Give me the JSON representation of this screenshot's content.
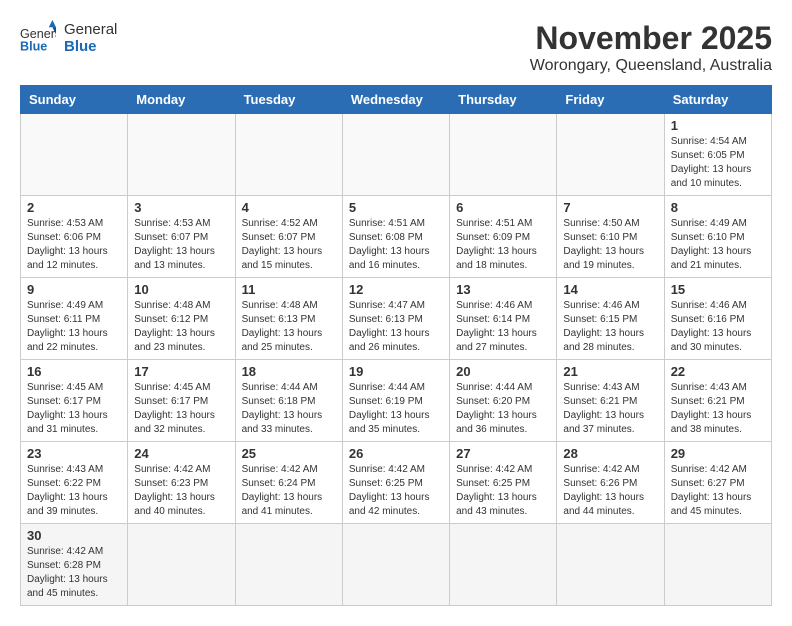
{
  "header": {
    "logo_general": "General",
    "logo_blue": "Blue",
    "month": "November 2025",
    "location": "Worongary, Queensland, Australia"
  },
  "weekdays": [
    "Sunday",
    "Monday",
    "Tuesday",
    "Wednesday",
    "Thursday",
    "Friday",
    "Saturday"
  ],
  "weeks": [
    [
      {
        "day": "",
        "info": ""
      },
      {
        "day": "",
        "info": ""
      },
      {
        "day": "",
        "info": ""
      },
      {
        "day": "",
        "info": ""
      },
      {
        "day": "",
        "info": ""
      },
      {
        "day": "",
        "info": ""
      },
      {
        "day": "1",
        "info": "Sunrise: 4:54 AM\nSunset: 6:05 PM\nDaylight: 13 hours and 10 minutes."
      }
    ],
    [
      {
        "day": "2",
        "info": "Sunrise: 4:53 AM\nSunset: 6:06 PM\nDaylight: 13 hours and 12 minutes."
      },
      {
        "day": "3",
        "info": "Sunrise: 4:53 AM\nSunset: 6:07 PM\nDaylight: 13 hours and 13 minutes."
      },
      {
        "day": "4",
        "info": "Sunrise: 4:52 AM\nSunset: 6:07 PM\nDaylight: 13 hours and 15 minutes."
      },
      {
        "day": "5",
        "info": "Sunrise: 4:51 AM\nSunset: 6:08 PM\nDaylight: 13 hours and 16 minutes."
      },
      {
        "day": "6",
        "info": "Sunrise: 4:51 AM\nSunset: 6:09 PM\nDaylight: 13 hours and 18 minutes."
      },
      {
        "day": "7",
        "info": "Sunrise: 4:50 AM\nSunset: 6:10 PM\nDaylight: 13 hours and 19 minutes."
      },
      {
        "day": "8",
        "info": "Sunrise: 4:49 AM\nSunset: 6:10 PM\nDaylight: 13 hours and 21 minutes."
      }
    ],
    [
      {
        "day": "9",
        "info": "Sunrise: 4:49 AM\nSunset: 6:11 PM\nDaylight: 13 hours and 22 minutes."
      },
      {
        "day": "10",
        "info": "Sunrise: 4:48 AM\nSunset: 6:12 PM\nDaylight: 13 hours and 23 minutes."
      },
      {
        "day": "11",
        "info": "Sunrise: 4:48 AM\nSunset: 6:13 PM\nDaylight: 13 hours and 25 minutes."
      },
      {
        "day": "12",
        "info": "Sunrise: 4:47 AM\nSunset: 6:13 PM\nDaylight: 13 hours and 26 minutes."
      },
      {
        "day": "13",
        "info": "Sunrise: 4:46 AM\nSunset: 6:14 PM\nDaylight: 13 hours and 27 minutes."
      },
      {
        "day": "14",
        "info": "Sunrise: 4:46 AM\nSunset: 6:15 PM\nDaylight: 13 hours and 28 minutes."
      },
      {
        "day": "15",
        "info": "Sunrise: 4:46 AM\nSunset: 6:16 PM\nDaylight: 13 hours and 30 minutes."
      }
    ],
    [
      {
        "day": "16",
        "info": "Sunrise: 4:45 AM\nSunset: 6:17 PM\nDaylight: 13 hours and 31 minutes."
      },
      {
        "day": "17",
        "info": "Sunrise: 4:45 AM\nSunset: 6:17 PM\nDaylight: 13 hours and 32 minutes."
      },
      {
        "day": "18",
        "info": "Sunrise: 4:44 AM\nSunset: 6:18 PM\nDaylight: 13 hours and 33 minutes."
      },
      {
        "day": "19",
        "info": "Sunrise: 4:44 AM\nSunset: 6:19 PM\nDaylight: 13 hours and 35 minutes."
      },
      {
        "day": "20",
        "info": "Sunrise: 4:44 AM\nSunset: 6:20 PM\nDaylight: 13 hours and 36 minutes."
      },
      {
        "day": "21",
        "info": "Sunrise: 4:43 AM\nSunset: 6:21 PM\nDaylight: 13 hours and 37 minutes."
      },
      {
        "day": "22",
        "info": "Sunrise: 4:43 AM\nSunset: 6:21 PM\nDaylight: 13 hours and 38 minutes."
      }
    ],
    [
      {
        "day": "23",
        "info": "Sunrise: 4:43 AM\nSunset: 6:22 PM\nDaylight: 13 hours and 39 minutes."
      },
      {
        "day": "24",
        "info": "Sunrise: 4:42 AM\nSunset: 6:23 PM\nDaylight: 13 hours and 40 minutes."
      },
      {
        "day": "25",
        "info": "Sunrise: 4:42 AM\nSunset: 6:24 PM\nDaylight: 13 hours and 41 minutes."
      },
      {
        "day": "26",
        "info": "Sunrise: 4:42 AM\nSunset: 6:25 PM\nDaylight: 13 hours and 42 minutes."
      },
      {
        "day": "27",
        "info": "Sunrise: 4:42 AM\nSunset: 6:25 PM\nDaylight: 13 hours and 43 minutes."
      },
      {
        "day": "28",
        "info": "Sunrise: 4:42 AM\nSunset: 6:26 PM\nDaylight: 13 hours and 44 minutes."
      },
      {
        "day": "29",
        "info": "Sunrise: 4:42 AM\nSunset: 6:27 PM\nDaylight: 13 hours and 45 minutes."
      }
    ],
    [
      {
        "day": "30",
        "info": "Sunrise: 4:42 AM\nSunset: 6:28 PM\nDaylight: 13 hours and 45 minutes."
      },
      {
        "day": "",
        "info": ""
      },
      {
        "day": "",
        "info": ""
      },
      {
        "day": "",
        "info": ""
      },
      {
        "day": "",
        "info": ""
      },
      {
        "day": "",
        "info": ""
      },
      {
        "day": "",
        "info": ""
      }
    ]
  ]
}
